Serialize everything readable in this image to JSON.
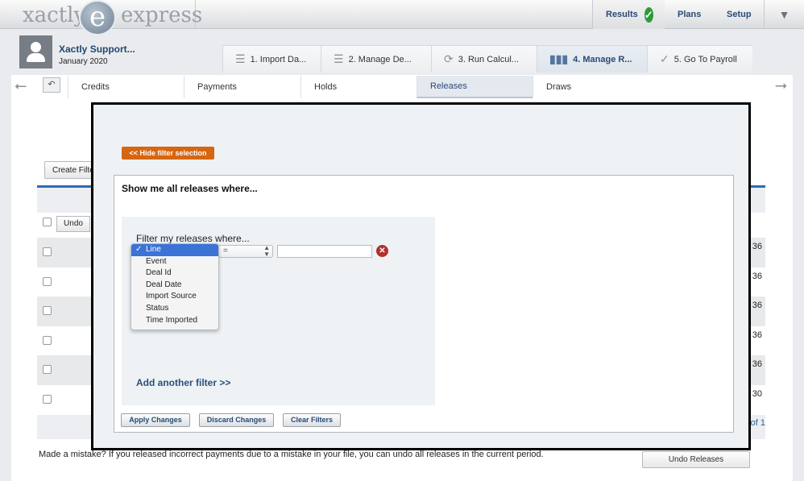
{
  "app": {
    "logo_left": "xactly",
    "logo_mark": "e",
    "logo_right": "express"
  },
  "top_nav": {
    "results": "Results",
    "plans": "Plans",
    "setup": "Setup",
    "dropdown_icon": "caret-down-icon"
  },
  "user": {
    "name": "Xactly Support...",
    "period": "January 2020"
  },
  "steps": [
    {
      "label": "1. Import Da...",
      "icon": "list-icon"
    },
    {
      "label": "2. Manage De...",
      "icon": "list-icon"
    },
    {
      "label": "3. Run Calcul...",
      "icon": "refresh-icon"
    },
    {
      "label": "4. Manage R...",
      "icon": "bar-chart-icon"
    },
    {
      "label": "5. Go To Payroll",
      "icon": "check-icon"
    }
  ],
  "subtabs": [
    "Credits",
    "Payments",
    "Holds",
    "Releases",
    "Draws"
  ],
  "background": {
    "create_filter": "Create Filte",
    "undo": "Undo",
    "row_values": [
      "36",
      "36",
      "36",
      "36",
      "36",
      "30"
    ],
    "pagination": "of 1",
    "mistake_text": "Made a mistake? If you released incorrect payments due to a mistake in your file, you can undo all releases in the current period.",
    "undo_releases": "Undo Releases"
  },
  "modal": {
    "hide_filter": "<< Hide filter selection",
    "title": "Show me all releases where...",
    "filter_heading": "Filter my releases where...",
    "operator": "=",
    "value": "",
    "field_options": [
      "Line",
      "Event",
      "Deal Id",
      "Deal Date",
      "Import Source",
      "Status",
      "Time Imported"
    ],
    "selected_field": "Line",
    "add_filter": "Add another filter >>",
    "apply": "Apply Changes",
    "discard": "Discard Changes",
    "clear": "Clear Filters"
  },
  "colors": {
    "accent_blue": "#2c6bb3",
    "orange": "#d56613",
    "remove_red": "#b2302b",
    "success_green": "#2d9b3a"
  }
}
